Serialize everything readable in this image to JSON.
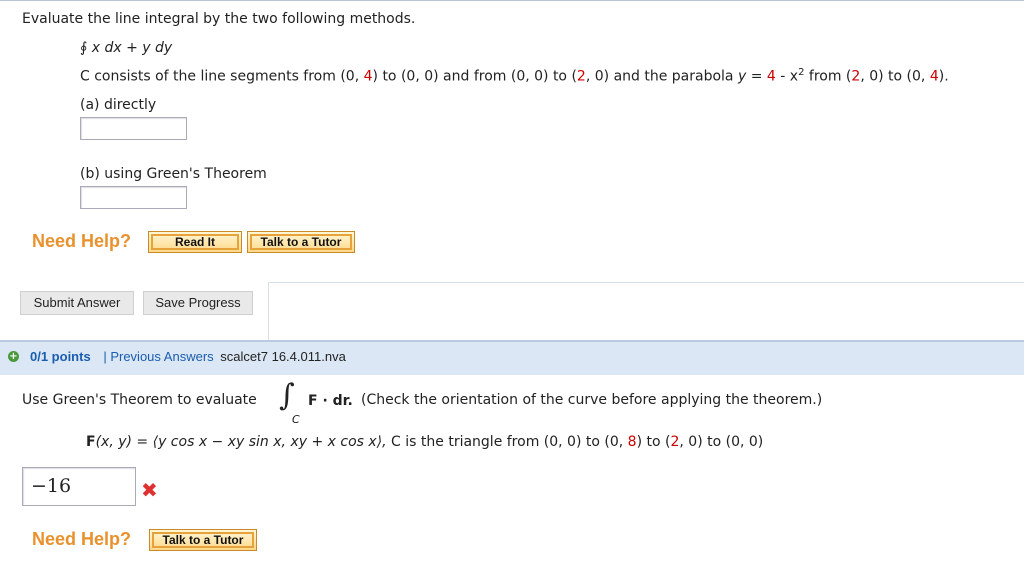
{
  "q1": {
    "instruction": "Evaluate the line integral by the two following methods.",
    "integral_symbol": "∮",
    "integral_expr": "x dx + y dy",
    "curve_prefix": "C consists of the line segments from (0, ",
    "p1": "4",
    "curve_mid1": ") to (0, 0) and from (0, 0) to (",
    "p2": "2",
    "curve_mid2": ", 0) and the parabola ",
    "parabola_y": "y",
    "parabola_eq": " = ",
    "p3": "4",
    "parabola_minus": " - x",
    "parabola_exp": "2",
    "curve_from": " from (",
    "p4": "2",
    "curve_to": ", 0) to (0, ",
    "p5": "4",
    "curve_end": ").",
    "part_a": "(a) directly",
    "part_b": "(b) using Green's Theorem",
    "need_help": "Need Help?",
    "read_it": "Read It",
    "talk_tutor": "Talk to a Tutor",
    "submit": "Submit Answer",
    "save": "Save Progress"
  },
  "q2": {
    "points": "0/1 points",
    "sep": "|",
    "previous": "Previous Answers",
    "code": "scalcet7 16.4.011.nva",
    "use_text": "Use Green's Theorem to evaluate",
    "integral_sign": "∫",
    "integral_sub": "C",
    "F_dr": "F · dr.",
    "check_text": "(Check the orientation of the curve before applying the theorem.)",
    "F_label": "F",
    "F_args": "(x, y) = ",
    "F_body": "⟨y cos x − xy sin x, xy + x cos x⟩,",
    "tri_prefix": " C is the triangle from (0, 0) to (0, ",
    "t1": "8",
    "tri_mid": ") to (",
    "t2": "2",
    "tri_end": ", 0) to (0, 0)",
    "answer": "−16",
    "wrong_mark": "✖",
    "need_help": "Need Help?",
    "talk_tutor": "Talk to a Tutor"
  },
  "colors": {
    "accent_orange": "#e8912d",
    "link_blue": "#1a5db0",
    "error_red": "#e03030",
    "number_red": "#cc0000"
  }
}
